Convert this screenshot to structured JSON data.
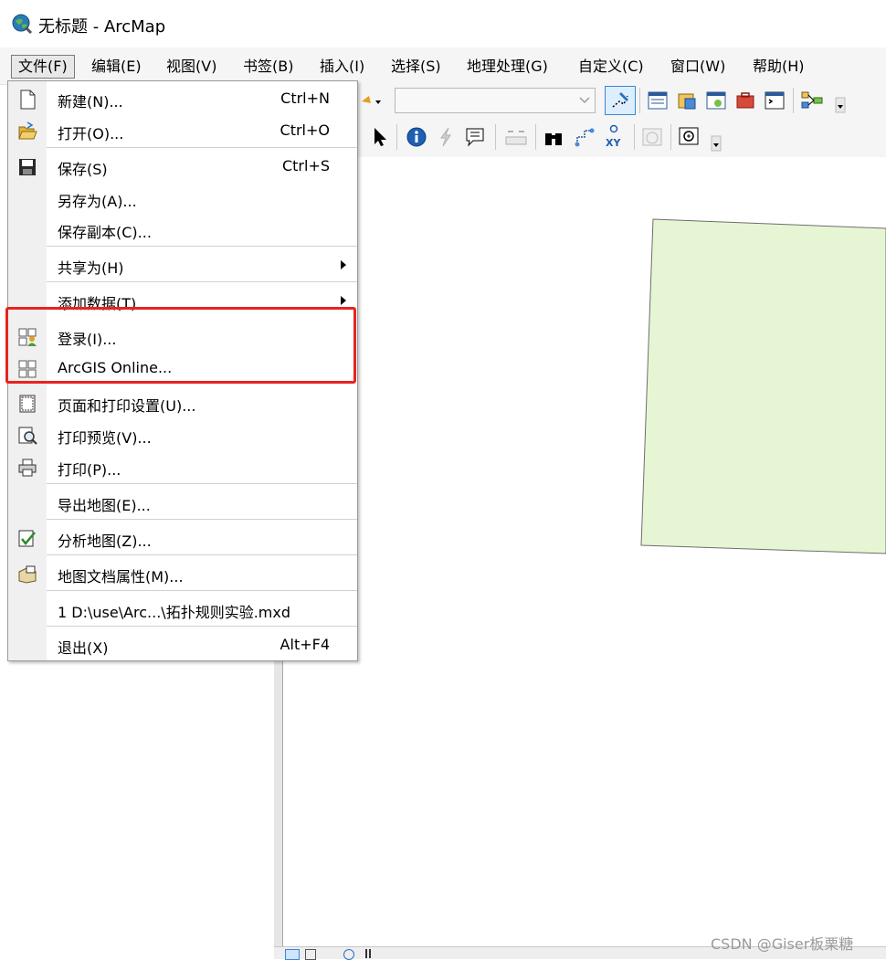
{
  "window": {
    "title": "无标题 - ArcMap",
    "app_icon": "arcmap-globe-icon"
  },
  "menubar": {
    "items": [
      {
        "label": "文件(F)"
      },
      {
        "label": "编辑(E)"
      },
      {
        "label": "视图(V)"
      },
      {
        "label": "书签(B)"
      },
      {
        "label": "插入(I)"
      },
      {
        "label": "选择(S)"
      },
      {
        "label": "地理处理(G)"
      },
      {
        "label": "自定义(C)"
      },
      {
        "label": "窗口(W)"
      },
      {
        "label": "帮助(H)"
      }
    ],
    "active_index": 0
  },
  "file_menu": {
    "items": [
      {
        "label": "新建(N)...",
        "shortcut": "Ctrl+N",
        "icon": "new-document-icon"
      },
      {
        "label": "打开(O)...",
        "shortcut": "Ctrl+O",
        "icon": "open-folder-icon"
      },
      {
        "label": "保存(S)",
        "shortcut": "Ctrl+S",
        "icon": "save-disk-icon"
      },
      {
        "label": "另存为(A)..."
      },
      {
        "label": "保存副本(C)..."
      },
      {
        "label": "共享为(H)",
        "submenu": true
      },
      {
        "label": "添加数据(T)",
        "submenu": true
      },
      {
        "label": "登录(I)...",
        "icon": "sign-in-icon"
      },
      {
        "label": "ArcGIS Online...",
        "icon": "arcgis-online-grid-icon"
      },
      {
        "label": "页面和打印设置(U)...",
        "icon": "page-setup-icon"
      },
      {
        "label": "打印预览(V)...",
        "icon": "print-preview-icon"
      },
      {
        "label": "打印(P)...",
        "icon": "printer-icon"
      },
      {
        "label": "导出地图(E)..."
      },
      {
        "label": "分析地图(Z)...",
        "icon": "analyze-map-icon"
      },
      {
        "label": "地图文档属性(M)...",
        "icon": "map-properties-icon"
      },
      {
        "label": "1 D:\\use\\Arc...\\拓扑规则实验.mxd"
      },
      {
        "label": "退出(X)",
        "shortcut": "Alt+F4"
      }
    ]
  },
  "highlight": {
    "color": "#e8231f",
    "items": [
      "登录(I)...",
      "ArcGIS Online..."
    ]
  },
  "map": {
    "polygon_fill": "#e6f6d4",
    "polygon_stroke": "#6e6e6e"
  },
  "watermark": "CSDN @Giser板栗糖"
}
